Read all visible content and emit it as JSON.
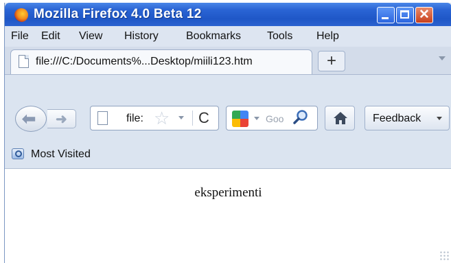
{
  "window": {
    "title": "Mozilla Firefox 4.0 Beta 12",
    "controls": [
      "minimize-icon",
      "maximize-icon",
      "close-icon"
    ]
  },
  "menubar": {
    "items": [
      {
        "label": "File",
        "accel": "F"
      },
      {
        "label": "Edit",
        "accel": "E"
      },
      {
        "label": "View",
        "accel": "V"
      },
      {
        "label": "History",
        "accel": "s"
      },
      {
        "label": "Bookmarks",
        "accel": "B"
      },
      {
        "label": "Tools",
        "accel": "T"
      },
      {
        "label": "Help",
        "accel": "H"
      }
    ]
  },
  "tabs": {
    "active_label": "file:///C:/Documents%...Desktop/miili123.htm",
    "new_tab_label": "+"
  },
  "navbar": {
    "url_text": "file:",
    "search_placeholder": "Goo",
    "search_engine_icon": "google-icon",
    "feedback_label": "Feedback"
  },
  "bookmarks": {
    "most_visited_label": "Most Visited"
  },
  "content": {
    "text": "eksperimenti"
  },
  "colors": {
    "titlebar": "#2a64d4",
    "chrome": "#dbe4f0",
    "close_button": "#c8401c"
  }
}
